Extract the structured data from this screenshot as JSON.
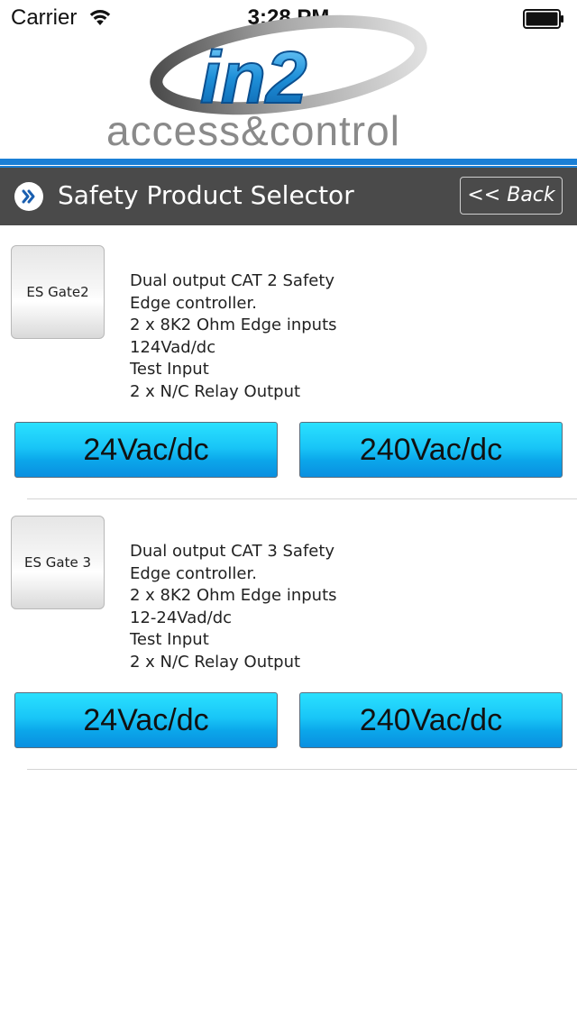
{
  "status_bar": {
    "carrier": "Carrier",
    "time": "3:28 PM"
  },
  "logo": {
    "brand": "in2",
    "tagline_part1": "access",
    "tagline_amp": "&",
    "tagline_part2": "control"
  },
  "header": {
    "title": "Safety Product Selector",
    "back_label": "<< Back"
  },
  "products": [
    {
      "name": "ES Gate2",
      "description": [
        "Dual output CAT 2 Safety",
        "Edge controller.",
        "2 x 8K2 Ohm Edge inputs",
        "124Vad/dc",
        "Test Input",
        "2 x N/C Relay Output"
      ],
      "buttons": [
        "24Vac/dc",
        "240Vac/dc"
      ]
    },
    {
      "name": "ES Gate 3",
      "description": [
        "Dual output CAT 3 Safety",
        "Edge controller.",
        "2 x 8K2 Ohm Edge inputs",
        "12-24Vad/dc",
        "Test Input",
        "2 x N/C Relay Output"
      ],
      "buttons": [
        "24Vac/dc",
        "240Vac/dc"
      ]
    }
  ],
  "colors": {
    "accent_blue": "#1a7fd6",
    "title_bar": "#4a4a4a",
    "button_cyan": "#19c6f7"
  },
  "icons": {
    "wifi": "wifi-icon",
    "battery": "battery-icon",
    "title": "double-chevron-right-icon"
  }
}
